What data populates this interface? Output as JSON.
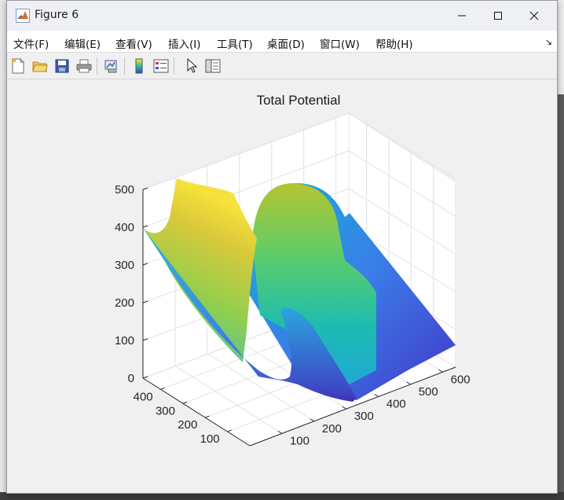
{
  "window": {
    "title": "Figure 6"
  },
  "menu": [
    "文件(F)",
    "编辑(E)",
    "查看(V)",
    "插入(I)",
    "工具(T)",
    "桌面(D)",
    "窗口(W)",
    "帮助(H)"
  ],
  "toolbar": {
    "buttons": [
      "new-figure",
      "open-file",
      "save",
      "print",
      "link-plot",
      "colorbar",
      "legend",
      "edit-plot",
      "property-inspector"
    ]
  },
  "chart_data": {
    "type": "surface",
    "title": "Total Potential",
    "z_ticks": [
      "0",
      "100",
      "200",
      "300",
      "400",
      "500"
    ],
    "x_ticks": [
      "100",
      "200",
      "300",
      "400",
      "500",
      "600"
    ],
    "y_ticks": [
      "100",
      "200",
      "300",
      "400"
    ],
    "zlim": [
      0,
      500
    ],
    "xlim": [
      0,
      640
    ],
    "ylim": [
      0,
      480
    ],
    "grid": true,
    "colormap": "parula",
    "view": "3-D default"
  }
}
